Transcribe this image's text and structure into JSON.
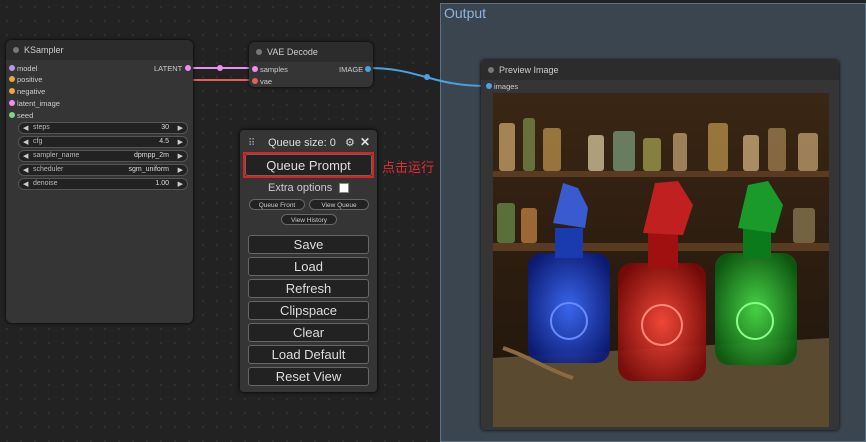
{
  "group": {
    "title": "Output"
  },
  "ksampler": {
    "title": "KSampler",
    "inputs": [
      "model",
      "positive",
      "negative",
      "latent_image",
      "seed"
    ],
    "output": "LATENT",
    "widgets": [
      {
        "name": "steps",
        "value": "30"
      },
      {
        "name": "cfg",
        "value": "4.5"
      },
      {
        "name": "sampler_name",
        "value": "dpmpp_2m"
      },
      {
        "name": "scheduler",
        "value": "sgm_uniform"
      },
      {
        "name": "denoise",
        "value": "1.00"
      }
    ]
  },
  "vae_decode": {
    "title": "VAE Decode",
    "inputs": [
      "samples",
      "vae"
    ],
    "output": "IMAGE"
  },
  "preview": {
    "title": "Preview Image",
    "input": "images"
  },
  "menu": {
    "queue_size": "Queue size: 0",
    "queue_prompt": "Queue Prompt",
    "extra_options": "Extra options",
    "queue_front": "Queue Front",
    "view_queue": "View Queue",
    "view_history": "View History",
    "buttons": [
      "Save",
      "Load",
      "Refresh",
      "Clipspace",
      "Clear",
      "Load Default",
      "Reset View"
    ]
  },
  "annotation": "点击运行",
  "colors": {
    "highlight": "#e02020",
    "group_bg": "#3a4550"
  }
}
